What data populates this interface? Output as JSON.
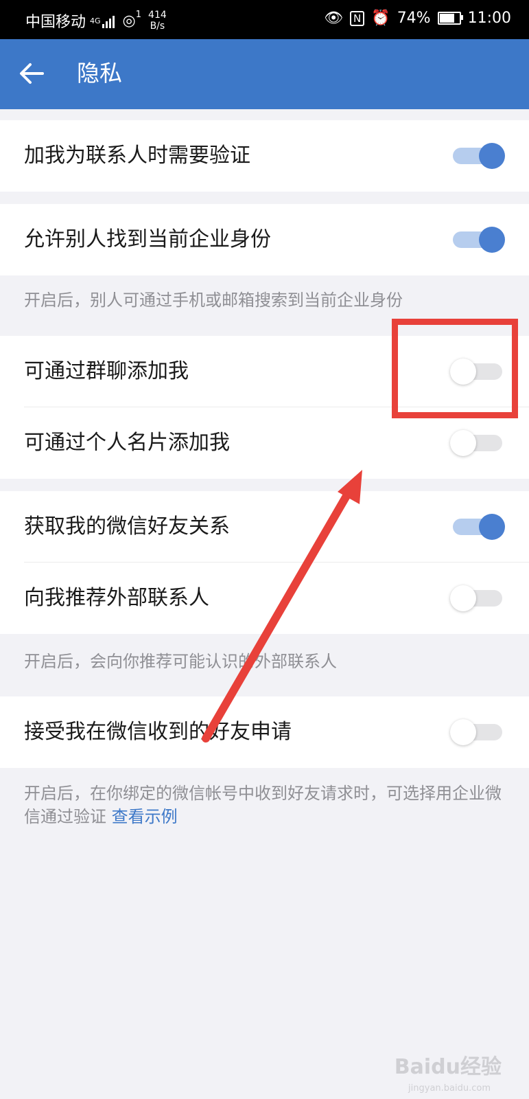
{
  "status_bar": {
    "carrier": "中国移动",
    "network": "4G",
    "speed_value": "414",
    "speed_unit": "B/s",
    "hotspot_count": "1",
    "battery": "74%",
    "time": "11:00"
  },
  "app_bar": {
    "title": "隐私"
  },
  "settings": [
    {
      "label": "加我为联系人时需要验证",
      "on": true
    },
    {
      "label": "允许别人找到当前企业身份",
      "on": true
    },
    {
      "label": "可通过群聊添加我",
      "on": false
    },
    {
      "label": "可通过个人名片添加我",
      "on": false
    },
    {
      "label": "获取我的微信好友关系",
      "on": true
    },
    {
      "label": "向我推荐外部联系人",
      "on": false
    },
    {
      "label": "接受我在微信收到的好友申请",
      "on": false
    }
  ],
  "hints": {
    "find_identity": "开启后，别人可通过手机或邮箱搜索到当前企业身份",
    "recommend": "开启后，会向你推荐可能认识的外部联系人",
    "wechat_request": "开启后，在你绑定的微信帐号中收到好友请求时，可选择用企业微信通过验证",
    "example_link": "查看示例"
  },
  "watermark": {
    "text": "Baidu经验",
    "sub": "jingyan.baidu.com"
  },
  "colors": {
    "accent": "#3d78c8",
    "toggle_on": "#4a7fd0",
    "annotation": "#e8413a"
  }
}
